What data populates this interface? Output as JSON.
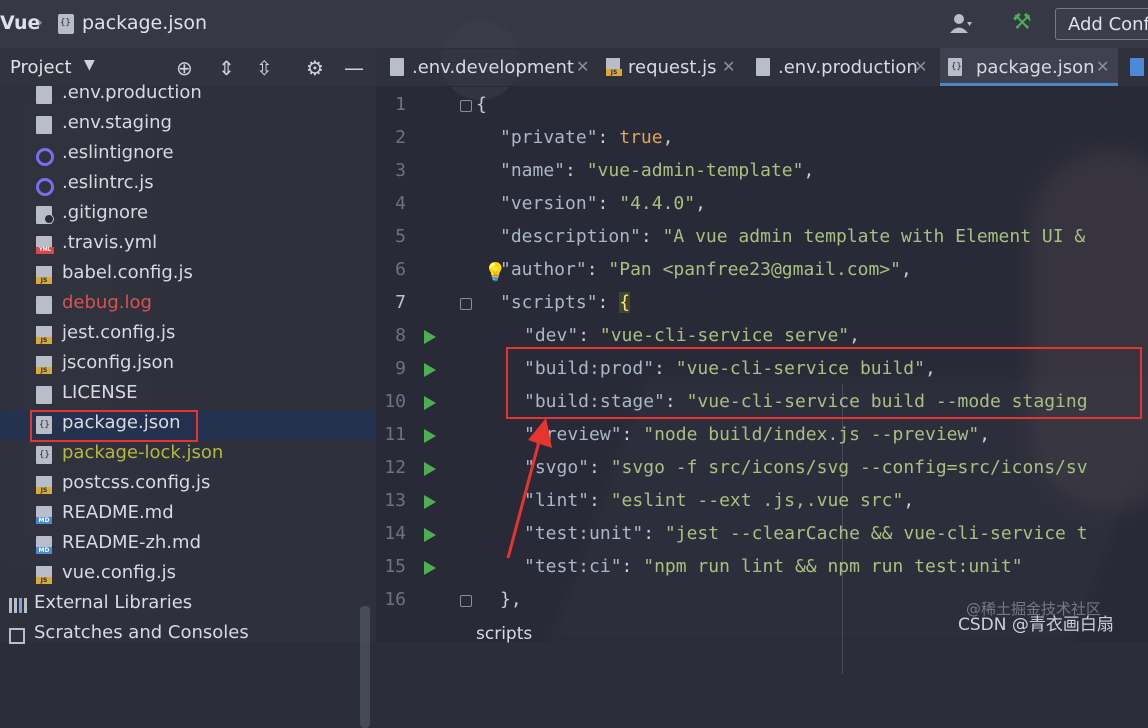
{
  "breadcrumb": {
    "project": "Vue",
    "file": "package.json"
  },
  "topbar": {
    "add_config_label": "Add Conf"
  },
  "project_panel": {
    "title": "Project"
  },
  "tree": [
    {
      "label": "env.production",
      "display": ".env.production",
      "icon": "file-icon",
      "color": "#d7dae2"
    },
    {
      "display": ".env.staging",
      "icon": "file-icon",
      "color": "#d7dae2"
    },
    {
      "display": ".eslintignore",
      "icon": "eslint-icon",
      "color": "#d7dae2"
    },
    {
      "display": ".eslintrc.js",
      "icon": "eslint-icon",
      "color": "#d7dae2"
    },
    {
      "display": ".gitignore",
      "icon": "ignore-file-icon",
      "color": "#d7dae2"
    },
    {
      "display": ".travis.yml",
      "icon": "yml-file-icon",
      "color": "#d7dae2"
    },
    {
      "display": "babel.config.js",
      "icon": "js-file-icon",
      "color": "#d7dae2"
    },
    {
      "display": "debug.log",
      "icon": "file-icon",
      "color": "#d9534f"
    },
    {
      "display": "jest.config.js",
      "icon": "js-file-icon",
      "color": "#d7dae2"
    },
    {
      "display": "jsconfig.json",
      "icon": "js-file-icon",
      "color": "#d7dae2"
    },
    {
      "display": "LICENSE",
      "icon": "file-icon",
      "color": "#d7dae2"
    },
    {
      "display": "package.json",
      "icon": "json-file-icon",
      "color": "#d7dae2"
    },
    {
      "display": "package-lock.json",
      "icon": "json-file-icon",
      "color": "#b5b840"
    },
    {
      "display": "postcss.config.js",
      "icon": "js-file-icon",
      "color": "#d7dae2"
    },
    {
      "display": "README.md",
      "icon": "md-file-icon",
      "color": "#d7dae2"
    },
    {
      "display": "README-zh.md",
      "icon": "md-file-icon",
      "color": "#d7dae2"
    },
    {
      "display": "vue.config.js",
      "icon": "js-file-icon",
      "color": "#d7dae2"
    }
  ],
  "tree_extra": {
    "external_libraries": "External Libraries",
    "scratches": "Scratches and Consoles"
  },
  "tabs": [
    {
      "label": ".env.development",
      "icon": "file-icon"
    },
    {
      "label": "request.js",
      "icon": "js-file-icon"
    },
    {
      "label": ".env.production",
      "icon": "file-icon"
    },
    {
      "label": "package.json",
      "icon": "json-file-icon",
      "active": true
    }
  ],
  "code": [
    {
      "n": "1",
      "text": "{"
    },
    {
      "n": "2",
      "key": "\"private\"",
      "val": "true",
      "val_kind": "kw",
      "tail": ","
    },
    {
      "n": "3",
      "key": "\"name\"",
      "val": "\"vue-admin-template\"",
      "tail": ","
    },
    {
      "n": "4",
      "key": "\"version\"",
      "val": "\"4.4.0\"",
      "tail": ","
    },
    {
      "n": "5",
      "key": "\"description\"",
      "val": "\"A vue admin template with Element UI &",
      "tail": ""
    },
    {
      "n": "6",
      "key": "\"author\"",
      "val": "\"Pan <panfree23@gmail.com>\"",
      "tail": ","
    },
    {
      "n": "7",
      "key": "\"scripts\"",
      "val": "{",
      "val_kind": "br",
      "tail": ""
    },
    {
      "n": "8",
      "key": "\"dev\"",
      "val": "\"vue-cli-service serve\"",
      "tail": ","
    },
    {
      "n": "9",
      "key": "\"build:prod\"",
      "val": "\"vue-cli-service build\"",
      "tail": ","
    },
    {
      "n": "10",
      "key": "\"build:stage\"",
      "val": "\"vue-cli-service build --mode staging",
      "tail": ""
    },
    {
      "n": "11",
      "key": "\"preview\"",
      "val": "\"node build/index.js --preview\"",
      "tail": ","
    },
    {
      "n": "12",
      "key": "\"svgo\"",
      "val": "\"svgo -f src/icons/svg --config=src/icons/sv",
      "tail": ""
    },
    {
      "n": "13",
      "key": "\"lint\"",
      "val": "\"eslint --ext .js,.vue src\"",
      "tail": ","
    },
    {
      "n": "14",
      "key": "\"test:unit\"",
      "val": "\"jest --clearCache && vue-cli-service t",
      "tail": ""
    },
    {
      "n": "15",
      "key": "\"test:ci\"",
      "val": "\"npm run lint && npm run test:unit\"",
      "tail": ""
    },
    {
      "n": "16",
      "text": "},"
    }
  ],
  "footer": {
    "breadcrumb": "scripts"
  },
  "watermark": {
    "top": "@稀土掘金技术社区",
    "bottom": "CSDN @青衣画白扇"
  },
  "colors": {
    "highlight_box": "#e8342e",
    "accent": "#4a88c7",
    "run": "#4caf50"
  }
}
